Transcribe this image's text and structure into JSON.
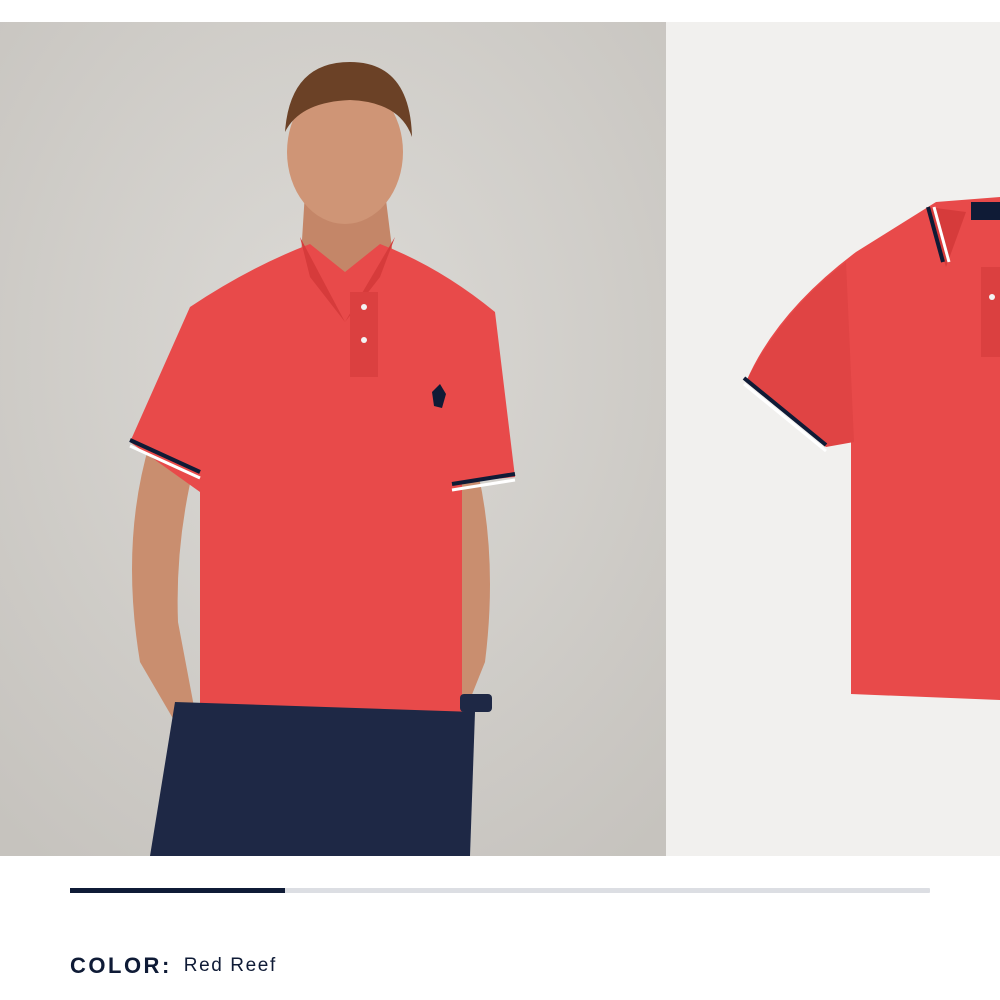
{
  "carousel": {
    "progress_fraction": 0.25,
    "slides": [
      {
        "image": "model-wearing-polo-photo"
      },
      {
        "image": "polo-shirt-flat-photo"
      }
    ]
  },
  "color_selector": {
    "label": "COLOR:",
    "value": "Red Reef"
  },
  "colors": {
    "shirt": "#e84a4a",
    "navy": "#0f1b36",
    "track": "#dcdee3"
  }
}
